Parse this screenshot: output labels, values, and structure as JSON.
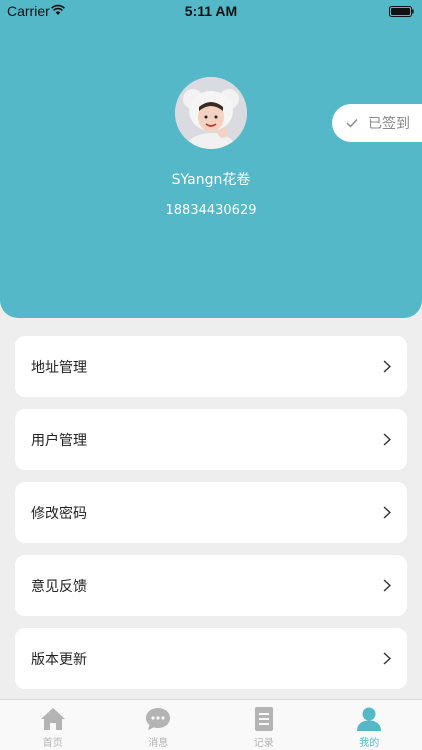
{
  "status_bar": {
    "carrier": "Carrier",
    "time": "5:11 AM"
  },
  "profile": {
    "nickname": "SYangn花卷",
    "phone": "18834430629"
  },
  "signin": {
    "label": "已签到"
  },
  "menu": [
    {
      "label": "地址管理"
    },
    {
      "label": "用户管理"
    },
    {
      "label": "修改密码"
    },
    {
      "label": "意见反馈"
    },
    {
      "label": "版本更新"
    }
  ],
  "tabbar": [
    {
      "label": "首页",
      "icon": "home-icon"
    },
    {
      "label": "消息",
      "icon": "message-icon"
    },
    {
      "label": "记录",
      "icon": "record-icon"
    },
    {
      "label": "我的",
      "icon": "profile-icon",
      "active": true
    }
  ],
  "colors": {
    "accent": "#55b8c9",
    "background": "#eeeeee",
    "tab_inactive": "#b4b4b4"
  }
}
